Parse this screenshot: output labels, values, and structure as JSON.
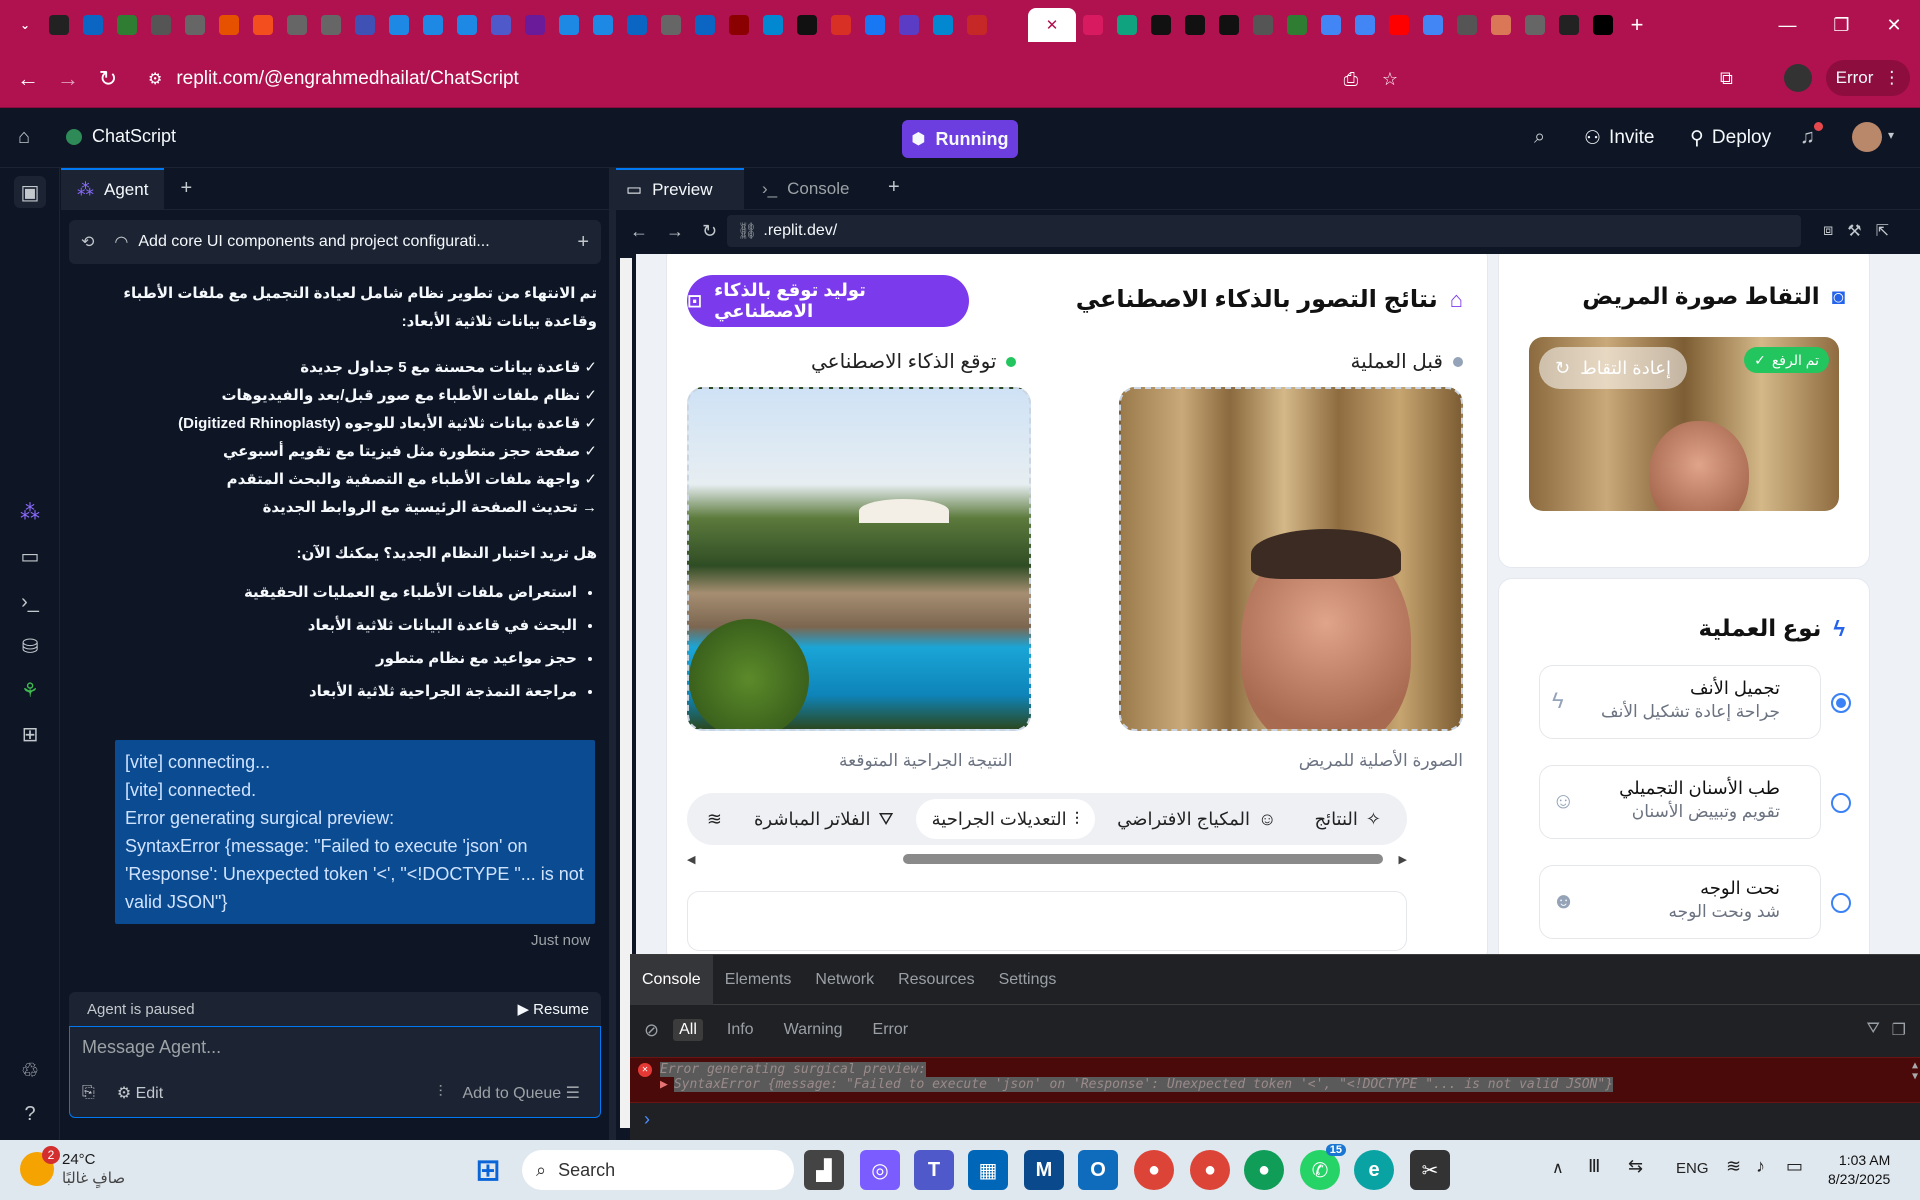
{
  "browser": {
    "url": "replit.com/@engrahmedhailat/ChatScript",
    "profile_error": "Error",
    "tab_icons": [
      "chevron-down-icon",
      "triangle-logo-icon",
      "openai-icon",
      "circle-icon",
      "notion-n-icon",
      "globe-icon",
      "globe-icon",
      "office-icon",
      "figma-icon",
      "globe-icon",
      "globe-icon",
      "s-icon",
      "grid-icon",
      "grid-icon",
      "grid-icon",
      "teams-icon",
      "u-icon",
      "gpt-icon",
      "grid-icon",
      "linkedin-icon",
      "globe-icon",
      "linkedin-icon",
      "app-icon",
      "compass-icon",
      "x-icon",
      "gmail-icon",
      "facebook-icon",
      "heart-icon",
      "settings-icon",
      "j-icon",
      "replit-icon",
      "globe-icon",
      "google-icon",
      "chatgpt-icon",
      "b-icon",
      "b-icon",
      "m-icon",
      "chrome-icon",
      "green-icon",
      "google-icon",
      "google-icon",
      "youtube-icon",
      "google-icon",
      "chrome-icon",
      "claude-icon",
      "globe-icon",
      "r-icon"
    ],
    "new_tab": "+"
  },
  "replit": {
    "project_name": "ChatScript",
    "status": "Running",
    "invite": "Invite",
    "deploy": "Deploy"
  },
  "agent": {
    "tab_label": "Agent",
    "chat_title": "Add core UI components and project configurati...",
    "message_intro": "تم الانتهاء من تطوير نظام شامل لعيادة التجميل مع ملفات الأطباء وقاعدة بيانات ثلاثية الأبعاد:",
    "checks": [
      "✓ قاعدة بيانات محسنة مع 5 جداول جديدة",
      "✓ نظام ملفات الأطباء مع صور قبل/بعد والفيديوهات",
      "✓ قاعدة بيانات ثلاثية الأبعاد للوجوه (Digitized Rhinoplasty)",
      "✓ صفحة حجز متطورة مثل فيزيتا مع تقويم أسبوعي",
      "✓ واجهة ملفات الأطباء مع التصفية والبحث المتقدم",
      "→ تحديث الصفحة الرئيسية مع الروابط الجديدة"
    ],
    "question": "هل تريد اختبار النظام الجديد؟ يمكنك الآن:",
    "bullets": [
      "استعراض ملفات الأطباء مع العمليات الحقيقية",
      "البحث في قاعدة البيانات ثلاثية الأبعاد",
      "حجز مواعيد مع نظام متطور",
      "مراجعة النمذجة الجراحية ثلاثية الأبعاد"
    ],
    "log_lines": [
      "[vite] connecting...",
      "[vite] connected.",
      "Error generating surgical preview:",
      "SyntaxError {message: \"Failed to execute 'json' on 'Response': Unexpected token '<', \"<!DOCTYPE \"... is not valid JSON\"}"
    ],
    "log_time": "Just now",
    "paused_text": "Agent is paused",
    "resume": "Resume",
    "placeholder": "Message Agent...",
    "edit": "Edit",
    "add_to_queue": "Add to Queue"
  },
  "preview": {
    "tab_preview": "Preview",
    "tab_console": "Console",
    "url": ".replit.dev/",
    "results_title": "نتائج التصور بالذكاء الاصطناعي",
    "generate_button": "توليد توقع بالذكاء الاصطناعي",
    "before_label": "قبل العملية",
    "ai_label": "توقع الذكاء الاصطناعي",
    "before_caption": "الصورة الأصلية للمريض",
    "after_caption": "النتيجة الجراحية المتوقعة",
    "tabs": [
      "النتائج",
      "المكياج الافتراضي",
      "التعديلات الجراحية",
      "الفلاتر المباشرة"
    ],
    "capture_title": "التقاط صورة المريض",
    "uploaded_badge": "تم الرفع",
    "retake": "إعادة التقاط",
    "procedure_title": "نوع العملية",
    "procedures": [
      {
        "title": "تجميل الأنف",
        "subtitle": "جراحة إعادة تشكيل الأنف",
        "selected": true
      },
      {
        "title": "طب الأسنان التجميلي",
        "subtitle": "تقويم وتبييض الأسنان",
        "selected": false
      },
      {
        "title": "نحت الوجه",
        "subtitle": "شد ونحت الوجه",
        "selected": false
      }
    ]
  },
  "devtools": {
    "tabs": [
      "Console",
      "Elements",
      "Network",
      "Resources",
      "Settings"
    ],
    "filters": [
      "All",
      "Info",
      "Warning",
      "Error"
    ],
    "error_line1": "Error generating surgical preview:",
    "error_line2": "SyntaxError {message: \"Failed to execute 'json' on 'Response': Unexpected token '<', \"<!DOCTYPE \"... is not valid JSON\"}"
  },
  "taskbar": {
    "weather_temp": "24°C",
    "weather_desc": "صافٍ غالبًا",
    "weather_badge": "2",
    "search": "Search",
    "lang": "ENG",
    "time": "1:03 AM",
    "date": "8/23/2025",
    "whatsapp_badge": "15"
  }
}
